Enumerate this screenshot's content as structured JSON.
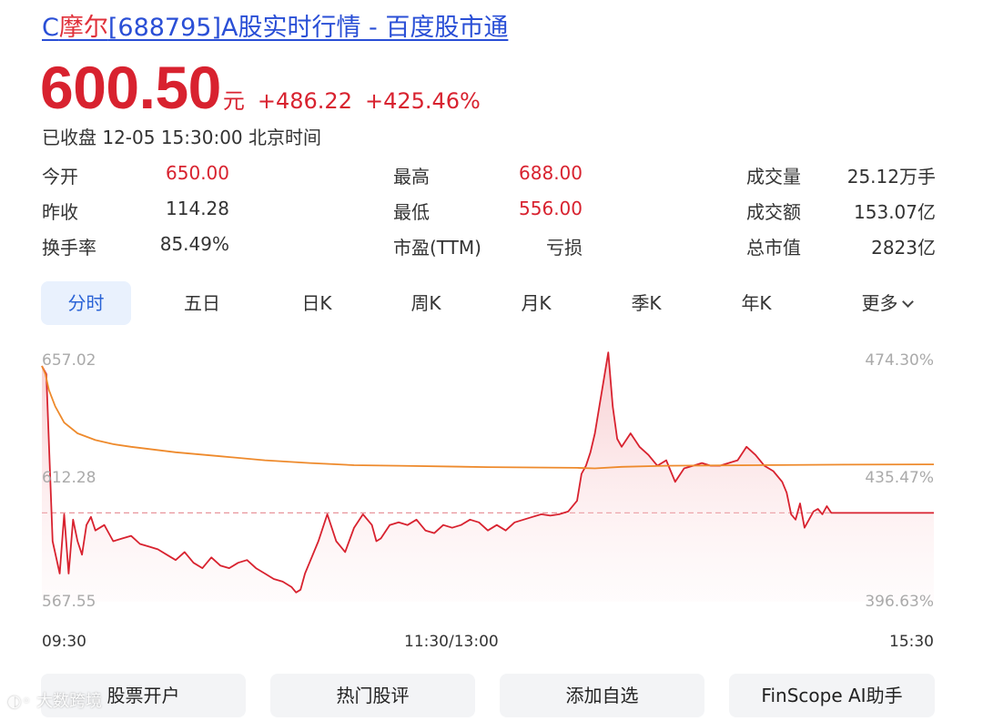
{
  "header": {
    "title_prefix": "C",
    "title_name": "摩尔",
    "title_rest": "[688795]A股实时行情 - 百度股市通"
  },
  "quote": {
    "price": "600.50",
    "unit": "元",
    "change": "+486.22",
    "change_pct": "+425.46%",
    "status": "已收盘 12-05 15:30:00 北京时间"
  },
  "stats": {
    "open_label": "今开",
    "open": "650.00",
    "prev_close_label": "昨收",
    "prev_close": "114.28",
    "turnover_rate_label": "换手率",
    "turnover_rate": "85.49%",
    "high_label": "最高",
    "high": "688.00",
    "low_label": "最低",
    "low": "556.00",
    "pe_label": "市盈(TTM)",
    "pe": "亏损",
    "volume_label": "成交量",
    "volume": "25.12万手",
    "amount_label": "成交额",
    "amount": "153.07亿",
    "market_cap_label": "总市值",
    "market_cap": "2823亿"
  },
  "tabs": [
    "分时",
    "五日",
    "日K",
    "周K",
    "月K",
    "季K",
    "年K",
    "更多"
  ],
  "active_tab": 0,
  "chart_data": {
    "type": "line",
    "y_left_ticks": [
      "657.02",
      "612.28",
      "567.55"
    ],
    "y_right_ticks": [
      "474.30%",
      "435.47%",
      "396.63%"
    ],
    "x_ticks": [
      "09:30",
      "11:30/13:00",
      "15:30"
    ],
    "ylim": [
      567.55,
      657.02
    ],
    "reference_price": 600.5,
    "colors": {
      "price": "#d8222f",
      "avg": "#ee8a2c",
      "ref": "#e8959b"
    },
    "series": [
      {
        "key": "price",
        "x": [
          0,
          0.005,
          0.012,
          0.02,
          0.025,
          0.03,
          0.035,
          0.04,
          0.045,
          0.05,
          0.055,
          0.06,
          0.07,
          0.08,
          0.09,
          0.1,
          0.11,
          0.12,
          0.13,
          0.14,
          0.15,
          0.16,
          0.17,
          0.18,
          0.19,
          0.2,
          0.21,
          0.22,
          0.23,
          0.24,
          0.25,
          0.26,
          0.27,
          0.28,
          0.285,
          0.29,
          0.295,
          0.3,
          0.31,
          0.32,
          0.33,
          0.335,
          0.34,
          0.35,
          0.36,
          0.37,
          0.375,
          0.38,
          0.39,
          0.4,
          0.41,
          0.42,
          0.43,
          0.44,
          0.45,
          0.46,
          0.47,
          0.48,
          0.49,
          0.5,
          0.51,
          0.52,
          0.53,
          0.54,
          0.55,
          0.56,
          0.57,
          0.58,
          0.59,
          0.6,
          0.605,
          0.61,
          0.615,
          0.62,
          0.625,
          0.63,
          0.635,
          0.64,
          0.645,
          0.65,
          0.66,
          0.67,
          0.68,
          0.69,
          0.7,
          0.71,
          0.72,
          0.73,
          0.74,
          0.75,
          0.76,
          0.77,
          0.78,
          0.79,
          0.8,
          0.81,
          0.82,
          0.83,
          0.835,
          0.84,
          0.845,
          0.85,
          0.855,
          0.86,
          0.865,
          0.87,
          0.875,
          0.88,
          0.885,
          0.89,
          0.9,
          0.95,
          1.0
        ],
        "y": [
          655.0,
          652.0,
          590.0,
          578.0,
          600.0,
          578.0,
          598.0,
          590.0,
          585.0,
          596.0,
          599.0,
          594.0,
          596.0,
          590.0,
          591.0,
          592.0,
          589.0,
          588.0,
          587.0,
          585.0,
          583.0,
          586.0,
          582.0,
          580.0,
          584.0,
          581.0,
          580.0,
          582.0,
          583.0,
          580.0,
          578.0,
          576.0,
          575.0,
          573.0,
          571.0,
          572.0,
          578.0,
          582.0,
          590.0,
          600.0,
          590.0,
          588.0,
          586.0,
          595.0,
          600.0,
          596.0,
          590.0,
          591.0,
          596.0,
          597.0,
          596.0,
          598.0,
          594.0,
          593.0,
          596.0,
          595.0,
          596.0,
          598.0,
          597.0,
          594.0,
          596.0,
          594.0,
          597.0,
          598.0,
          599.0,
          600.0,
          599.5,
          600.0,
          601.0,
          605.0,
          615.0,
          618.0,
          623.0,
          630.0,
          640.0,
          650.0,
          660.0,
          640.0,
          628.0,
          625.0,
          630.0,
          625.0,
          622.0,
          618.0,
          620.0,
          612.0,
          617.0,
          618.0,
          619.0,
          618.0,
          618.0,
          619.0,
          620.0,
          625.0,
          622.0,
          618.0,
          616.0,
          612.0,
          608.0,
          600.0,
          598.0,
          604.0,
          595.0,
          598.0,
          601.0,
          602.0,
          600.0,
          603.0,
          600.5,
          600.5,
          600.5,
          600.5,
          600.5
        ]
      },
      {
        "key": "avg",
        "x": [
          0,
          0.004,
          0.008,
          0.015,
          0.025,
          0.04,
          0.06,
          0.08,
          0.1,
          0.15,
          0.2,
          0.25,
          0.3,
          0.35,
          0.4,
          0.5,
          0.6,
          0.62,
          0.65,
          0.7,
          0.8,
          0.9,
          1.0
        ],
        "y": [
          655.0,
          652.0,
          646.0,
          640.0,
          634.0,
          630.0,
          627.5,
          626.0,
          625.0,
          623.0,
          621.5,
          620.0,
          619.0,
          618.2,
          618.0,
          617.5,
          617.2,
          617.0,
          617.6,
          618.0,
          618.2,
          618.4,
          618.5
        ]
      }
    ]
  },
  "actions": [
    "股票开户",
    "热门股评",
    "添加自选",
    "FinScope AI助手"
  ],
  "watermark": "大数跨境"
}
